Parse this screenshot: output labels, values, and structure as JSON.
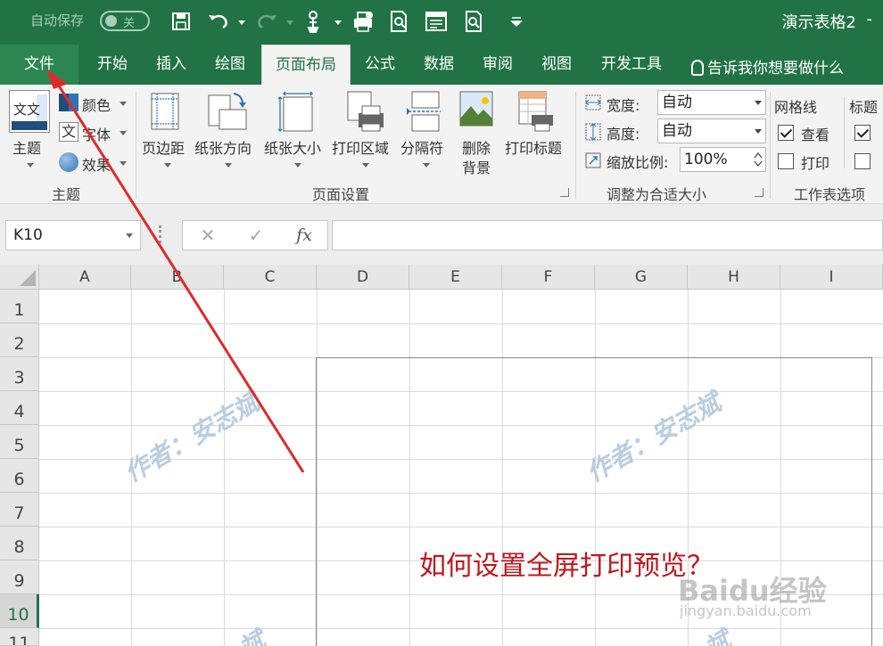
{
  "titlebar": {
    "autosave_label": "自动保存",
    "autosave_state": "关",
    "doc_title": "演示表格2",
    "title_dash": "-"
  },
  "tabs": {
    "file": "文件",
    "items": [
      "开始",
      "插入",
      "绘图",
      "页面布局",
      "公式",
      "数据",
      "审阅",
      "视图",
      "开发工具"
    ],
    "active": "页面布局",
    "tell_me": "告诉我你想要做什么"
  },
  "ribbon": {
    "theme_group": {
      "themes_label": "主题",
      "colors_label": "颜色",
      "fonts_label": "字体",
      "effects_label": "效果",
      "icon_text": "文文",
      "group_name": "主题"
    },
    "page_setup_group": {
      "margins": "页边距",
      "orientation": "纸张方向",
      "size": "纸张大小",
      "print_area": "打印区域",
      "breaks": "分隔符",
      "background_l1": "删除",
      "background_l2": "背景",
      "print_titles": "打印标题",
      "group_name": "页面设置"
    },
    "scale_group": {
      "width_label": "宽度:",
      "width_value": "自动",
      "height_label": "高度:",
      "height_value": "自动",
      "scale_label": "缩放比例:",
      "scale_value": "100%",
      "group_name": "调整为合适大小"
    },
    "sheet_options_group": {
      "gridlines_label": "网格线",
      "view_label": "查看",
      "print_label": "打印",
      "headings_label": "标题",
      "view_checked": true,
      "print_checked": false,
      "group_name": "工作表选项"
    }
  },
  "formula_bar": {
    "name_box": "K10",
    "cancel": "✕",
    "enter": "✓",
    "fx": "fx",
    "content": ""
  },
  "grid": {
    "columns": [
      "A",
      "B",
      "C",
      "D",
      "E",
      "F",
      "G",
      "H",
      "I"
    ],
    "rows": [
      "1",
      "2",
      "3",
      "4",
      "5",
      "6",
      "7",
      "8",
      "9",
      "10",
      "11"
    ],
    "selected_row": "10"
  },
  "overlay": {
    "watermark": "作者：安志斌",
    "watermark_partial": "斌",
    "caption": "如何设置全屏打印预览？",
    "baidu_logo": "Baidu经验",
    "baidu_url": "jingyan.baidu.com",
    "arrow_color": "#e02a2a"
  },
  "colors": {
    "brand": "#217346",
    "caption": "#c0161e"
  }
}
